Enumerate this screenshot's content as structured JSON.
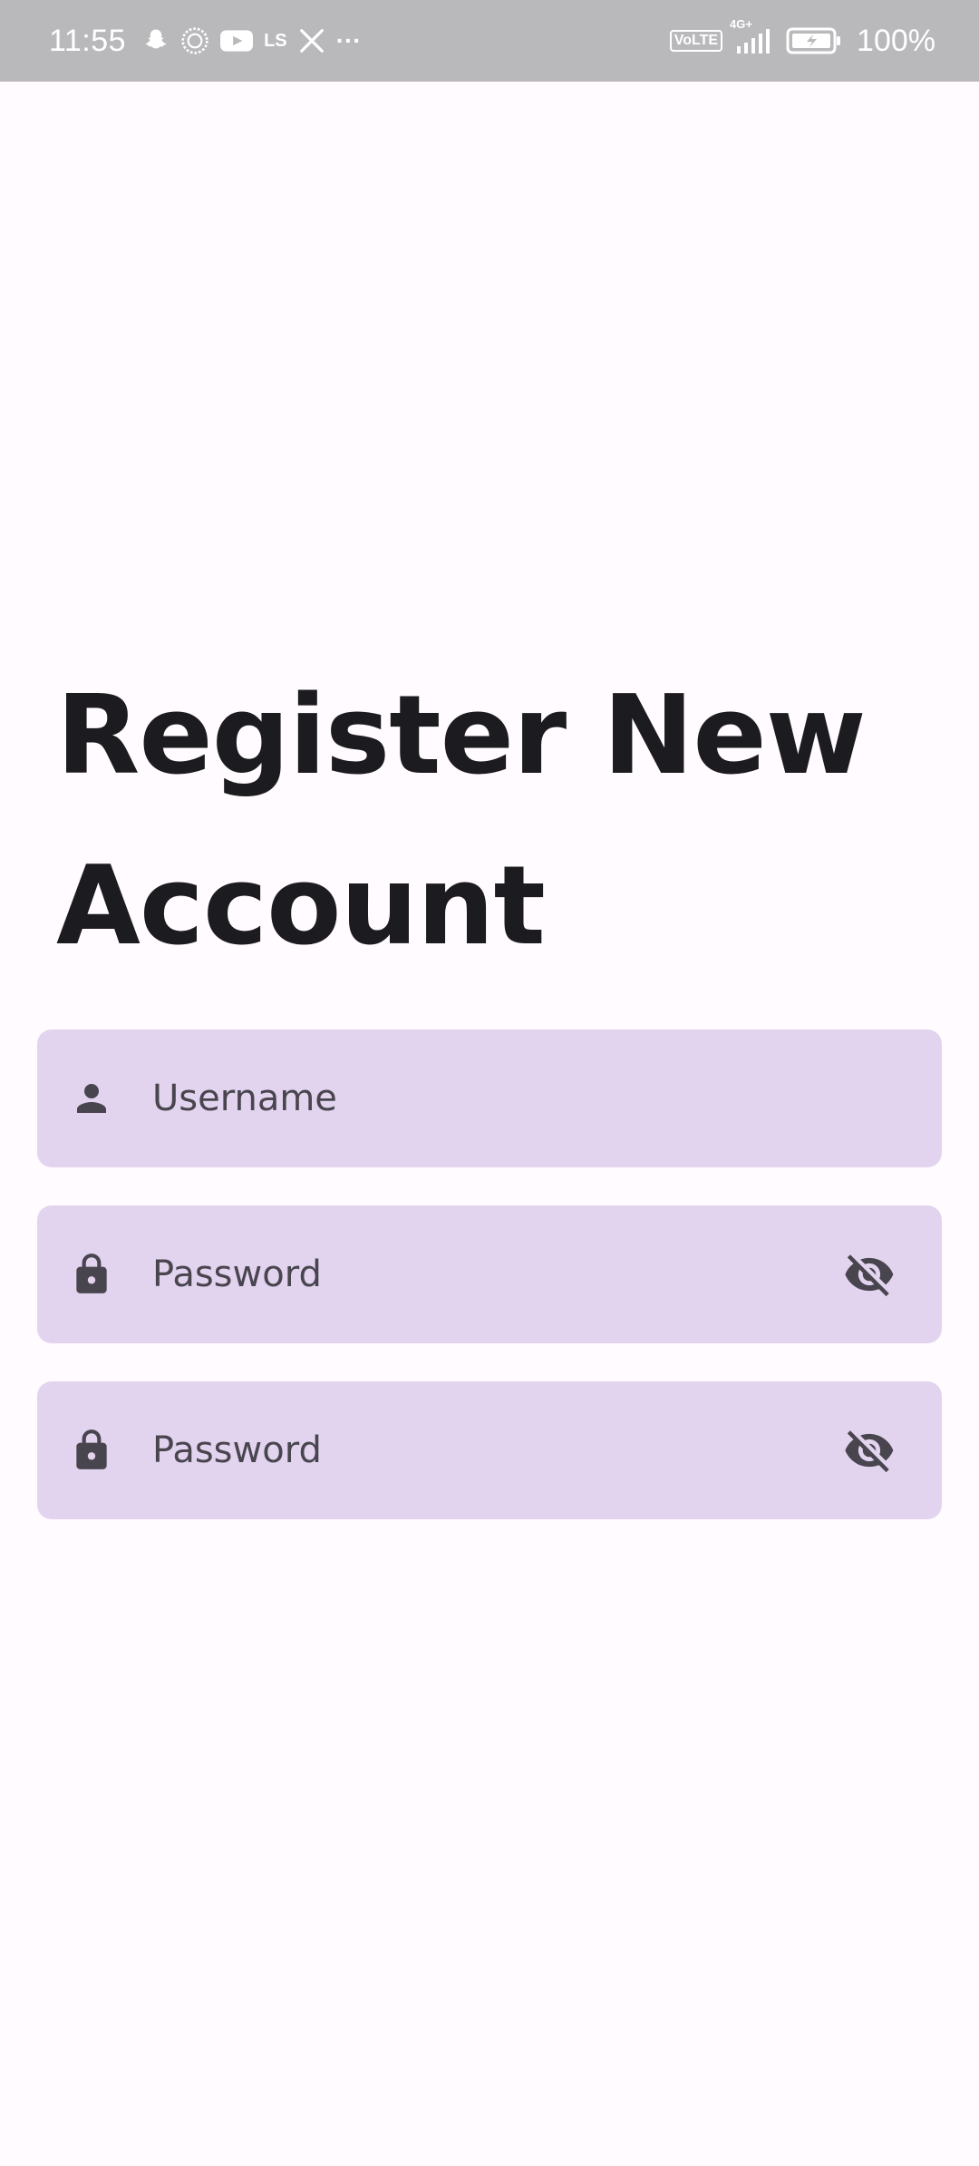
{
  "status_bar": {
    "time": "11:55",
    "icons": [
      "snapchat-icon",
      "vpn-icon",
      "youtube-icon",
      "ls-icon",
      "x-icon",
      "more-dots-icon"
    ],
    "ls_label": "LS",
    "more_label": "···",
    "volte_label": "VoLTE",
    "network_label": "4G+",
    "battery_percent": "100%"
  },
  "title": {
    "line1": "Register New",
    "line2": "Account"
  },
  "form": {
    "username": {
      "placeholder": "Username",
      "value": "",
      "icon": "person-icon"
    },
    "password": {
      "placeholder": "Password",
      "value": "",
      "icon": "lock-icon",
      "toggle_icon": "visibility-off-icon"
    },
    "confirm_password": {
      "placeholder": "Password",
      "value": "",
      "icon": "lock-icon",
      "toggle_icon": "visibility-off-icon"
    }
  },
  "colors": {
    "background": "#fffbfe",
    "status_bar": "#b9b8bb",
    "field_fill": "#e2d4ef",
    "title_text": "#1c1b1f",
    "field_text": "#49454f",
    "icon": "#49454f"
  }
}
